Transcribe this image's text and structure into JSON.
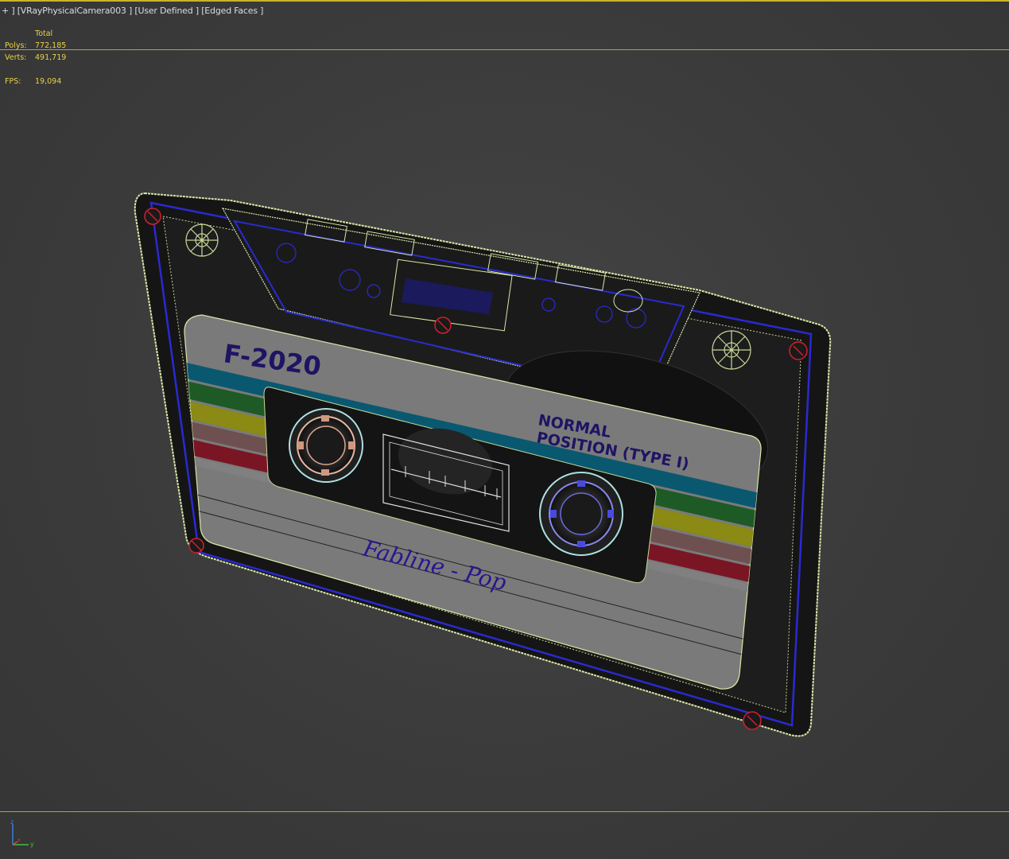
{
  "viewport_label": {
    "plus": "+ ]",
    "camera": "[VRayPhysicalCamera003 ]",
    "shading": "[User Defined ]",
    "display": "[Edged Faces ]"
  },
  "stats": {
    "header": "Total",
    "polys_label": "Polys:",
    "polys_value": "772,185",
    "verts_label": "Verts:",
    "verts_value": "491,719",
    "fps_label": "FPS:",
    "fps_value": "19,094"
  },
  "model_label": {
    "brand": "F-2020",
    "position_line1": "NORMAL",
    "position_line2": "POSITION (TYPE I)",
    "handwriting": "Fabline - Pop"
  },
  "gizmo": {
    "z": "z",
    "y": "y",
    "x": "x"
  },
  "colors": {
    "stats_text": "#e8d24a",
    "viewport_border": "#c9b42a",
    "wire_edges": "#d8e8a8",
    "wire_blue": "#2a2ad0",
    "screw_red": "#d02030"
  }
}
